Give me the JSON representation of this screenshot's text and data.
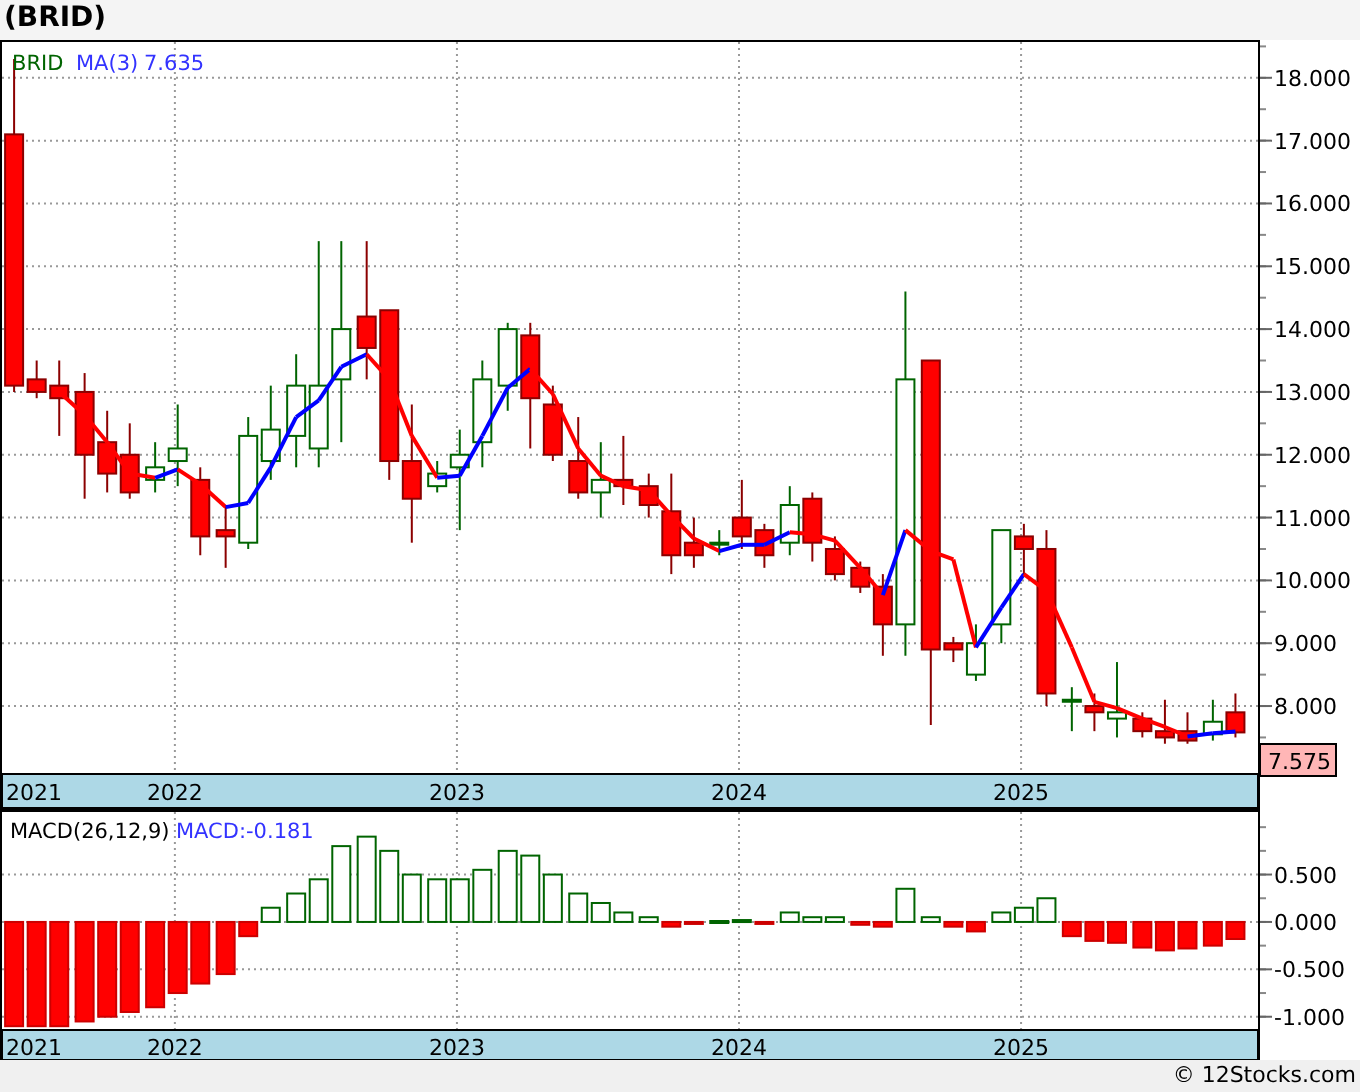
{
  "title": "(BRID)",
  "price_panel": {
    "legend": {
      "symbol": "BRID",
      "ma_label": "MA(3)",
      "ma_value": "7.635"
    },
    "last_price": "7.575",
    "start_year_label": "2021",
    "chart_data": {
      "type": "candlestick",
      "grid": true,
      "ylim": [
        6.95,
        18.57
      ],
      "xlim": [
        2021.38,
        2025.84
      ],
      "yticks": [
        {
          "value": 8,
          "label": "8.000"
        },
        {
          "value": 9,
          "label": "9.000"
        },
        {
          "value": 10,
          "label": "10.000"
        },
        {
          "value": 11,
          "label": "11.000"
        },
        {
          "value": 12,
          "label": "12.000"
        },
        {
          "value": 13,
          "label": "13.000"
        },
        {
          "value": 14,
          "label": "14.000"
        },
        {
          "value": 15,
          "label": "15.000"
        },
        {
          "value": 16,
          "label": "16.000"
        },
        {
          "value": 17,
          "label": "17.000"
        },
        {
          "value": 18,
          "label": "18.000"
        }
      ],
      "x": [
        2021.43,
        2021.51,
        2021.59,
        2021.68,
        2021.76,
        2021.84,
        2021.93,
        2022.01,
        2022.09,
        2022.18,
        2022.26,
        2022.34,
        2022.43,
        2022.51,
        2022.59,
        2022.68,
        2022.76,
        2022.84,
        2022.93,
        2023.01,
        2023.09,
        2023.18,
        2023.26,
        2023.34,
        2023.43,
        2023.51,
        2023.59,
        2023.68,
        2023.76,
        2023.84,
        2023.93,
        2024.01,
        2024.09,
        2024.18,
        2024.26,
        2024.34,
        2024.43,
        2024.51,
        2024.59,
        2024.68,
        2024.76,
        2024.84,
        2024.93,
        2025.01,
        2025.09,
        2025.18,
        2025.26,
        2025.34,
        2025.43,
        2025.51,
        2025.59,
        2025.68,
        2025.76
      ],
      "xticks": [
        {
          "value": 2022,
          "label": "2022"
        },
        {
          "value": 2023,
          "label": "2023"
        },
        {
          "value": 2024,
          "label": "2024"
        },
        {
          "value": 2025,
          "label": "2025"
        }
      ],
      "ohlc": [
        [
          17.1,
          18.3,
          13.0,
          13.1
        ],
        [
          13.2,
          13.5,
          12.9,
          13.0
        ],
        [
          13.1,
          13.5,
          12.3,
          12.9
        ],
        [
          13.0,
          13.3,
          11.3,
          12.0
        ],
        [
          12.2,
          12.7,
          11.4,
          11.7
        ],
        [
          12.0,
          12.5,
          11.3,
          11.4
        ],
        [
          11.6,
          12.2,
          11.4,
          11.8
        ],
        [
          11.9,
          12.8,
          11.5,
          12.1
        ],
        [
          11.6,
          11.8,
          10.4,
          10.7
        ],
        [
          10.8,
          11.2,
          10.2,
          10.7
        ],
        [
          10.6,
          12.6,
          10.5,
          12.3
        ],
        [
          11.9,
          13.1,
          11.6,
          12.4
        ],
        [
          12.3,
          13.6,
          11.8,
          13.1
        ],
        [
          12.1,
          15.4,
          11.8,
          13.1
        ],
        [
          13.2,
          15.4,
          12.2,
          14.0
        ],
        [
          14.2,
          15.4,
          13.2,
          13.7
        ],
        [
          14.3,
          14.3,
          11.6,
          11.9
        ],
        [
          11.9,
          12.8,
          10.6,
          11.3
        ],
        [
          11.5,
          11.9,
          11.4,
          11.7
        ],
        [
          11.8,
          12.4,
          10.8,
          12.0
        ],
        [
          12.2,
          13.5,
          11.8,
          13.2
        ],
        [
          13.1,
          14.1,
          12.7,
          14.0
        ],
        [
          13.9,
          14.1,
          12.1,
          12.9
        ],
        [
          12.8,
          13.1,
          11.9,
          12.0
        ],
        [
          11.9,
          12.6,
          11.3,
          11.4
        ],
        [
          11.4,
          12.2,
          11.0,
          11.6
        ],
        [
          11.6,
          12.3,
          11.2,
          11.5
        ],
        [
          11.5,
          11.7,
          11.0,
          11.2
        ],
        [
          11.1,
          11.7,
          10.1,
          10.4
        ],
        [
          10.6,
          11.0,
          10.2,
          10.4
        ],
        [
          10.6,
          10.8,
          10.4,
          10.6
        ],
        [
          11.0,
          11.6,
          10.5,
          10.7
        ],
        [
          10.8,
          10.9,
          10.2,
          10.4
        ],
        [
          10.6,
          11.5,
          10.4,
          11.2
        ],
        [
          11.3,
          11.4,
          10.3,
          10.6
        ],
        [
          10.5,
          10.7,
          10.0,
          10.1
        ],
        [
          10.2,
          10.3,
          9.8,
          9.9
        ],
        [
          9.9,
          10.1,
          8.8,
          9.3
        ],
        [
          9.3,
          14.6,
          8.8,
          13.2
        ],
        [
          13.5,
          13.5,
          7.7,
          8.9
        ],
        [
          9.0,
          9.1,
          8.7,
          8.9
        ],
        [
          8.5,
          9.3,
          8.4,
          9.0
        ],
        [
          9.3,
          10.8,
          9.0,
          10.8
        ],
        [
          10.7,
          10.9,
          10.1,
          10.5
        ],
        [
          10.5,
          10.8,
          8.0,
          8.2
        ],
        [
          8.1,
          8.3,
          7.6,
          8.1
        ],
        [
          8.0,
          8.2,
          7.6,
          7.9
        ],
        [
          7.8,
          8.7,
          7.5,
          7.9
        ],
        [
          7.8,
          7.9,
          7.5,
          7.6
        ],
        [
          7.6,
          8.1,
          7.4,
          7.5
        ],
        [
          7.6,
          7.9,
          7.4,
          7.45
        ],
        [
          7.55,
          8.1,
          7.45,
          7.75
        ],
        [
          7.9,
          8.2,
          7.5,
          7.58
        ]
      ]
    }
  },
  "macd_panel": {
    "legend": {
      "label": "MACD(26,12,9)",
      "value": "MACD:-0.181"
    },
    "start_year_label": "2021",
    "chart_data": {
      "type": "bar",
      "grid": true,
      "ylim": [
        -1.14,
        1.16
      ],
      "xlim": [
        2021.38,
        2025.84
      ],
      "yticks": [
        {
          "value": -1,
          "label": "-1.000"
        },
        {
          "value": -0.5,
          "label": "-0.500"
        },
        {
          "value": 0,
          "label": "0.000"
        },
        {
          "value": 0.5,
          "label": "0.500"
        }
      ],
      "x": [
        2021.43,
        2021.51,
        2021.59,
        2021.68,
        2021.76,
        2021.84,
        2021.93,
        2022.01,
        2022.09,
        2022.18,
        2022.26,
        2022.34,
        2022.43,
        2022.51,
        2022.59,
        2022.68,
        2022.76,
        2022.84,
        2022.93,
        2023.01,
        2023.09,
        2023.18,
        2023.26,
        2023.34,
        2023.43,
        2023.51,
        2023.59,
        2023.68,
        2023.76,
        2023.84,
        2023.93,
        2024.01,
        2024.09,
        2024.18,
        2024.26,
        2024.34,
        2024.43,
        2024.51,
        2024.59,
        2024.68,
        2024.76,
        2024.84,
        2024.93,
        2025.01,
        2025.09,
        2025.18,
        2025.26,
        2025.34,
        2025.43,
        2025.51,
        2025.59,
        2025.68,
        2025.76
      ],
      "xticks": [
        {
          "value": 2022,
          "label": "2022"
        },
        {
          "value": 2023,
          "label": "2023"
        },
        {
          "value": 2024,
          "label": "2024"
        },
        {
          "value": 2025,
          "label": "2025"
        }
      ],
      "values": [
        -1.1,
        -1.1,
        -1.1,
        -1.05,
        -1.0,
        -0.95,
        -0.9,
        -0.75,
        -0.65,
        -0.55,
        -0.15,
        0.15,
        0.3,
        0.45,
        0.8,
        0.9,
        0.75,
        0.5,
        0.45,
        0.45,
        0.55,
        0.75,
        0.7,
        0.5,
        0.3,
        0.2,
        0.1,
        0.05,
        -0.05,
        -0.02,
        0.01,
        0.02,
        -0.02,
        0.1,
        0.05,
        0.05,
        -0.03,
        -0.05,
        0.35,
        0.05,
        -0.05,
        -0.1,
        0.1,
        0.15,
        0.25,
        -0.15,
        -0.2,
        -0.22,
        -0.27,
        -0.3,
        -0.28,
        -0.25,
        -0.18
      ]
    }
  },
  "footer": "© 12Stocks.com"
}
